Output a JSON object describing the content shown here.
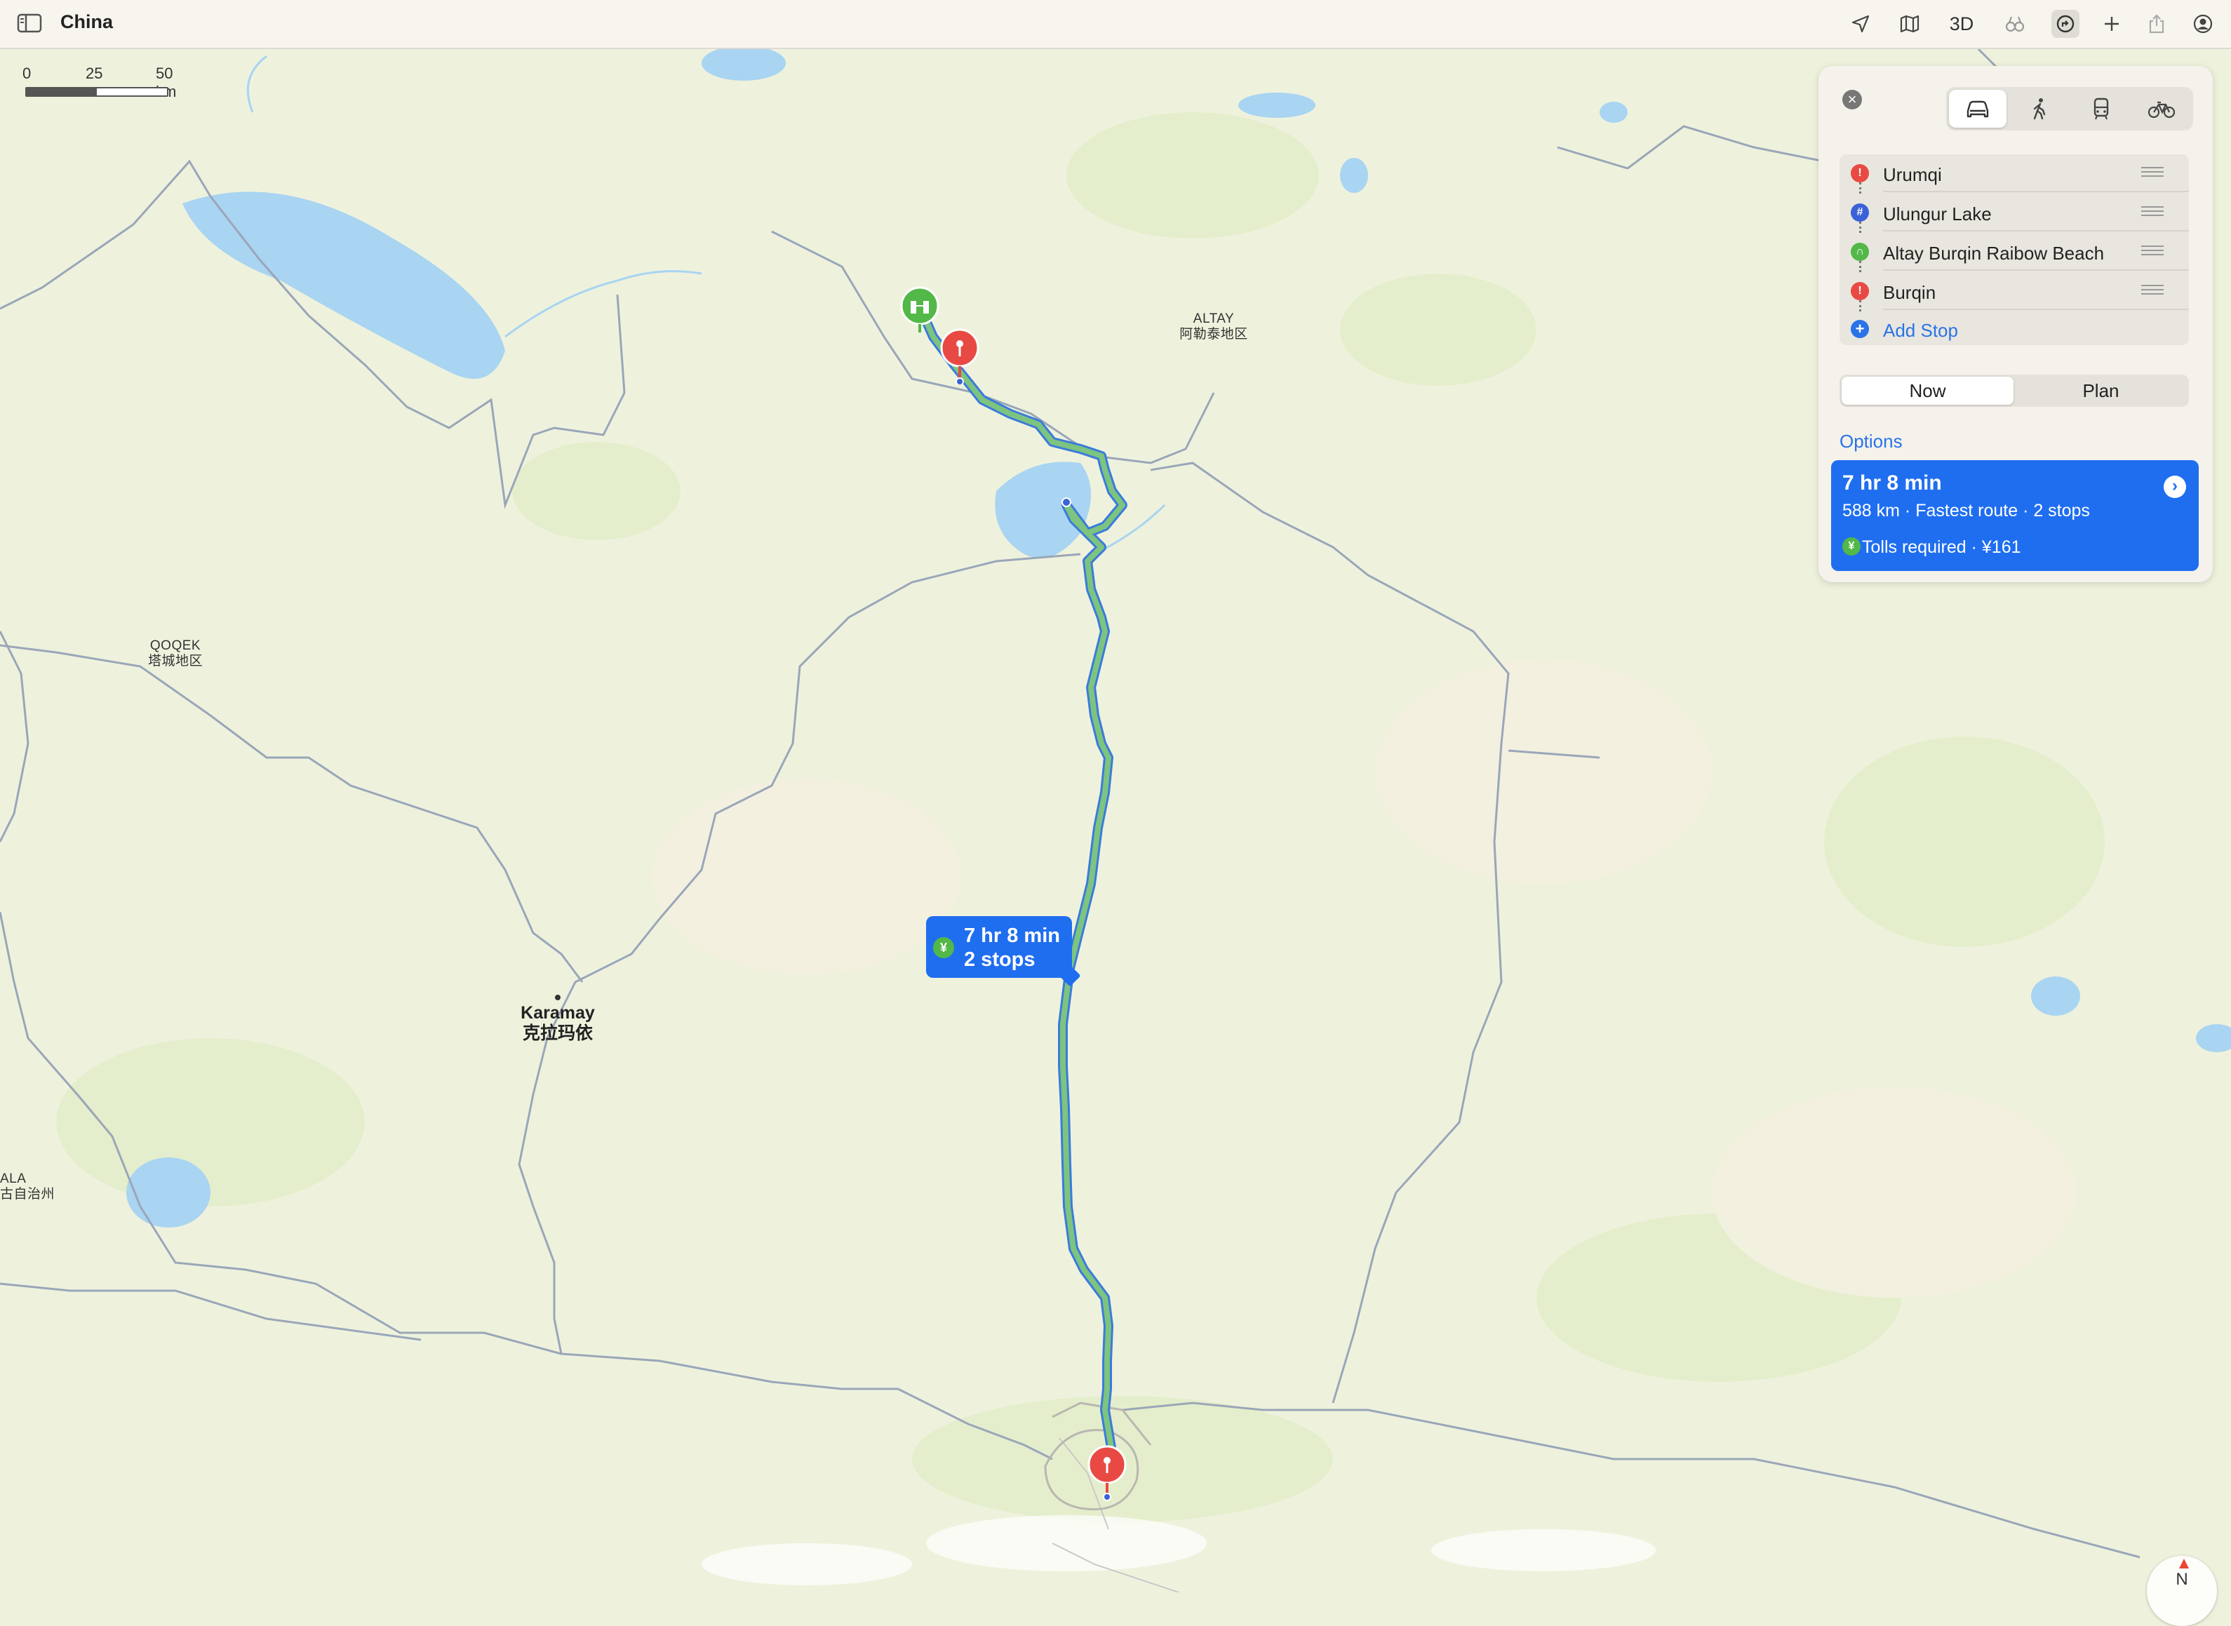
{
  "toolbar": {
    "title": "China",
    "mode_3d": "3D",
    "icons": [
      "sidebar-icon",
      "location-arrow-icon",
      "map-icon",
      "look-around-icon",
      "directions-icon",
      "plus-icon",
      "share-icon",
      "account-icon"
    ]
  },
  "map": {
    "scale": {
      "zero": "0",
      "mid": "25",
      "end": "50 km"
    },
    "labels": {
      "altay_en": "ALTAY",
      "altay_zh": "阿勒泰地区",
      "qoqek_en": "QOQEK",
      "qoqek_zh": "塔城地区",
      "karamay_en": "Karamay",
      "karamay_zh": "克拉玛依",
      "ala_en": "ALA",
      "ala_zh": "古自治州"
    },
    "callout": {
      "time": "7 hr 8 min",
      "stops": "2 stops",
      "toll_symbol": "¥"
    },
    "compass": "N"
  },
  "directions": {
    "close": "×",
    "transport_modes": [
      "drive",
      "walk",
      "transit",
      "cycle"
    ],
    "active_mode": "drive",
    "stops": [
      {
        "name": "Urumqi",
        "icon": "red-pin-icon",
        "color": "#e84a43"
      },
      {
        "name": "Ulungur Lake",
        "icon": "blue-grid-icon",
        "color": "#3a62d8"
      },
      {
        "name": "Altay Burqin Raibow Beach",
        "icon": "binoculars-icon",
        "color": "#52b848"
      },
      {
        "name": "Burqin",
        "icon": "red-pin-icon",
        "color": "#e84a43"
      }
    ],
    "add_stop": "Add Stop",
    "time_options": {
      "now": "Now",
      "plan": "Plan",
      "selected": "Now"
    },
    "options_link": "Options",
    "route": {
      "time": "7 hr 8 min",
      "detail": "588 km · Fastest route · 2 stops",
      "tolls": "Tolls required · ¥161",
      "toll_symbol": "¥"
    }
  },
  "colors": {
    "accent": "#1f6ef0",
    "route_green": "#7cc47f",
    "water": "#a9d4f2",
    "land": "#eef2dd",
    "pin_red": "#e84a43",
    "poi_green": "#52b848"
  }
}
